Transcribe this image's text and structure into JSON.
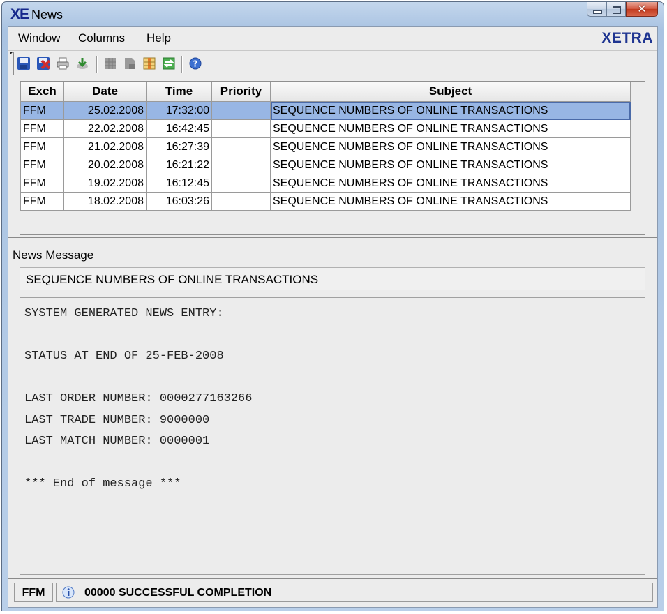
{
  "window": {
    "app_logo": "XE",
    "title": "News"
  },
  "menu": {
    "items": [
      "Window",
      "Columns",
      "Help"
    ],
    "brand": "XETRA"
  },
  "toolbar": {
    "icons": [
      "save-icon",
      "save-as-icon",
      "print-icon",
      "export-icon",
      "grid-icon",
      "document-icon",
      "columns-icon",
      "refresh-icon",
      "help-icon"
    ]
  },
  "table": {
    "columns": [
      "Exch",
      "Date",
      "Time",
      "Priority",
      "Subject"
    ],
    "rows": [
      [
        "FFM",
        "25.02.2008",
        "17:32:00",
        "",
        "SEQUENCE NUMBERS OF ONLINE TRANSACTIONS"
      ],
      [
        "FFM",
        "22.02.2008",
        "16:42:45",
        "",
        "SEQUENCE NUMBERS OF ONLINE TRANSACTIONS"
      ],
      [
        "FFM",
        "21.02.2008",
        "16:27:39",
        "",
        "SEQUENCE NUMBERS OF ONLINE TRANSACTIONS"
      ],
      [
        "FFM",
        "20.02.2008",
        "16:21:22",
        "",
        "SEQUENCE NUMBERS OF ONLINE TRANSACTIONS"
      ],
      [
        "FFM",
        "19.02.2008",
        "16:12:45",
        "",
        "SEQUENCE NUMBERS OF ONLINE TRANSACTIONS"
      ],
      [
        "FFM",
        "18.02.2008",
        "16:03:26",
        "",
        "SEQUENCE NUMBERS OF ONLINE TRANSACTIONS"
      ]
    ]
  },
  "news": {
    "label": "News Message",
    "subject": "SEQUENCE NUMBERS OF ONLINE TRANSACTIONS",
    "body_lines": [
      "SYSTEM GENERATED NEWS ENTRY:",
      "",
      "STATUS AT END OF 25-FEB-2008",
      "",
      "LAST ORDER NUMBER: 0000277163266",
      "LAST TRADE NUMBER: 9000000",
      "LAST MATCH NUMBER: 0000001",
      "",
      "*** End of message ***"
    ]
  },
  "status": {
    "exchange": "FFM",
    "message": "00000 SUCCESSFUL COMPLETION"
  },
  "colors": {
    "selection": "#98b6e4",
    "brand": "#1f3591"
  }
}
